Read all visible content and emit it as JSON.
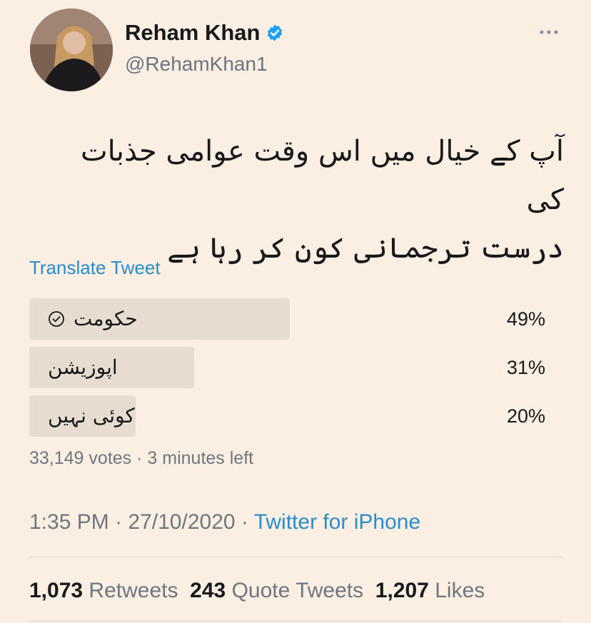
{
  "author": {
    "name": "Reham Khan",
    "handle": "@RehamKhan1"
  },
  "tweet": {
    "text_line1": "آپ کے خیال میں اس وقت عوامی جذبات کی",
    "text_line2": "درست ترجمانی کون کر رہا ہے",
    "translate_label": "Translate Tweet"
  },
  "poll": {
    "options": [
      {
        "label": "حکومت",
        "percent": "49%",
        "share": 0.49,
        "voted": true
      },
      {
        "label": "اپوزیشن",
        "percent": "31%",
        "share": 0.31,
        "voted": false
      },
      {
        "label": "کوئی نہیں",
        "percent": "20%",
        "share": 0.2,
        "voted": false
      }
    ],
    "votes": "33,149 votes",
    "separator": "·",
    "time_left": "3 minutes left"
  },
  "meta": {
    "time": "1:35 PM",
    "separator": "·",
    "date": "27/10/2020",
    "source": "Twitter for iPhone"
  },
  "stats": {
    "retweets_count": "1,073",
    "retweets_label": "Retweets",
    "quotes_count": "243",
    "quotes_label": "Quote Tweets",
    "likes_count": "1,207",
    "likes_label": "Likes"
  },
  "colors": {
    "background": "#fbeee2",
    "link": "#2a8cc9",
    "verified": "#1da1f2",
    "poll_bar": "#e6dccf"
  },
  "icons": [
    "verified-badge-icon",
    "more-options-icon",
    "voted-check-icon"
  ]
}
